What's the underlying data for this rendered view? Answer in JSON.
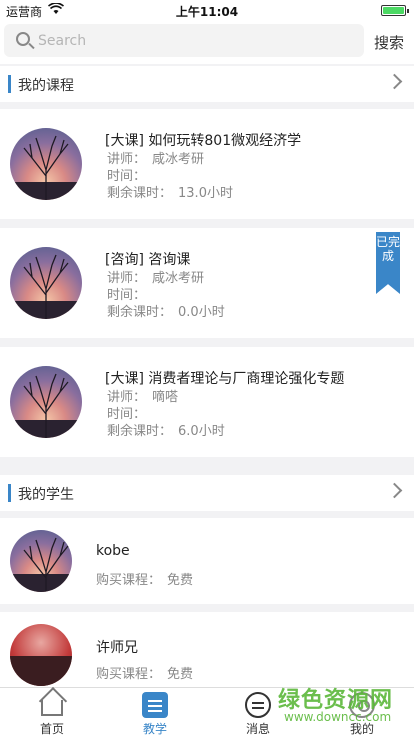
{
  "status_bar": {
    "carrier": "运营商",
    "time": "上午11:04"
  },
  "search": {
    "placeholder": "Search",
    "button_label": "搜索"
  },
  "courses_section": {
    "title": "我的课程"
  },
  "courses": [
    {
      "title": "[大课] 如何玩转801微观经济学",
      "teacher_label": "讲师：",
      "teacher": "咸冰考研",
      "time_label": "时间：",
      "time": "",
      "remaining_label": "剩余课时：",
      "remaining": "13.0小时"
    },
    {
      "title": "[咨询] 咨询课",
      "teacher_label": "讲师：",
      "teacher": "咸冰考研",
      "time_label": "时间：",
      "time": "",
      "remaining_label": "剩余课时：",
      "remaining": "0.0小时",
      "badge": "已完成"
    },
    {
      "title": "[大课] 消费者理论与厂商理论强化专题",
      "teacher_label": "讲师：",
      "teacher": "嘀嗒",
      "time_label": "时间：",
      "time": "",
      "remaining_label": "剩余课时：",
      "remaining": "6.0小时"
    }
  ],
  "students_section": {
    "title": "我的学生"
  },
  "students": [
    {
      "name": "kobe",
      "label": "购买课程：",
      "value": "免费"
    },
    {
      "name": "许师兄",
      "label": "购买课程：",
      "value": "免费"
    }
  ],
  "tabs": [
    {
      "label": "首页",
      "icon": "home-icon"
    },
    {
      "label": "教学",
      "icon": "teaching-icon",
      "active": true
    },
    {
      "label": "消息",
      "icon": "message-icon"
    },
    {
      "label": "我的",
      "icon": "profile-icon"
    }
  ],
  "watermark": {
    "line1": "绿色资源网",
    "line2": "www.downcc.com"
  },
  "colors": {
    "accent": "#3a86c8",
    "background": "#f2f2f4"
  }
}
